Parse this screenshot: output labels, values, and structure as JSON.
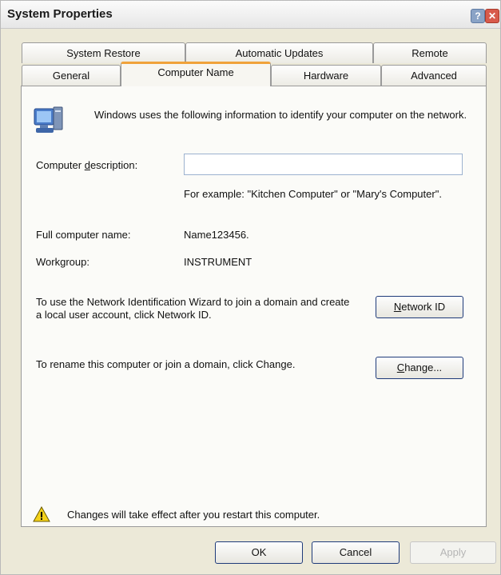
{
  "window": {
    "title": "System Properties",
    "help_label": "?",
    "close_label": "✕"
  },
  "tabs_top": [
    "System Restore",
    "Automatic Updates",
    "Remote"
  ],
  "tabs_bottom": [
    "General",
    "Computer Name",
    "Hardware",
    "Advanced"
  ],
  "active_tab": "Computer Name",
  "panel": {
    "intro": "Windows uses the following information to identify your computer on the network.",
    "description_label": "Computer description:",
    "description_value": "",
    "example": "For example: \"Kitchen Computer\" or \"Mary's Computer\".",
    "full_name_label": "Full computer name:",
    "full_name_value": "Name123456.",
    "workgroup_label": "Workgroup:",
    "workgroup_value": "INSTRUMENT",
    "network_text": "To use the Network Identification Wizard to join a domain and create a local user account, click Network ID.",
    "network_button": "Network ID",
    "rename_text": "To rename this computer or join a domain, click Change.",
    "change_button": "Change...",
    "warning": "Changes will take effect after you restart this computer."
  },
  "buttons": {
    "ok": "OK",
    "cancel": "Cancel",
    "apply": "Apply"
  },
  "colors": {
    "accent_tab": "#f0a23a",
    "dialog_bg": "#ece9d8",
    "button_border": "#1f3b7a"
  },
  "icons": [
    "computer-icon",
    "warning-icon",
    "help-icon",
    "close-icon"
  ]
}
